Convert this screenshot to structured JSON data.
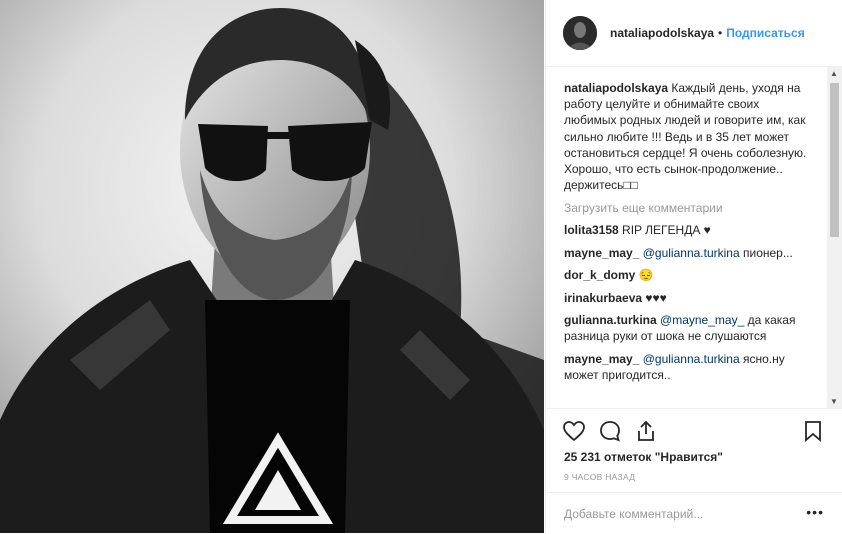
{
  "post": {
    "username": "nataliapodolskaya",
    "follow_label": "Подписаться",
    "separator": "•"
  },
  "caption": {
    "username": "nataliapodolskaya",
    "text": "Каждый день, уходя на работу целуйте и обнимайте своих любимых родных людей и говорите им, как сильно любите !!! Ведь и в 35 лет может остановиться сердце! Я очень соболезную. Хорошо, что есть сынок-продолжение.. держитесь"
  },
  "load_more_label": "Загрузить еще комментарии",
  "comments": [
    {
      "user": "lolita3158",
      "mention": "",
      "text": "RIP ЛЕГЕНДА ♥"
    },
    {
      "user": "mayne_may_",
      "mention": "@gulianna.turkina",
      "text": "пионер..."
    },
    {
      "user": "dor_k_domy",
      "mention": "",
      "text": "😔"
    },
    {
      "user": "irinakurbaeva",
      "mention": "",
      "text": "♥♥♥"
    },
    {
      "user": "gulianna.turkina",
      "mention": "@mayne_may_",
      "text": "да какая разница руки от шока не слушаются"
    },
    {
      "user": "mayne_may_",
      "mention": "@gulianna.turkina",
      "text": "ясно.ну может пригодится.."
    }
  ],
  "likes": {
    "count": "25 231",
    "text": "отметок \"Нравится\""
  },
  "time_ago": "9 часов назад",
  "add_comment": {
    "placeholder": "Добавьте комментарий..."
  },
  "icons": {
    "like": "heart-outline-icon",
    "comment": "comment-bubble-icon",
    "share": "share-upload-icon",
    "save": "bookmark-icon",
    "more": "more-dots-icon"
  }
}
